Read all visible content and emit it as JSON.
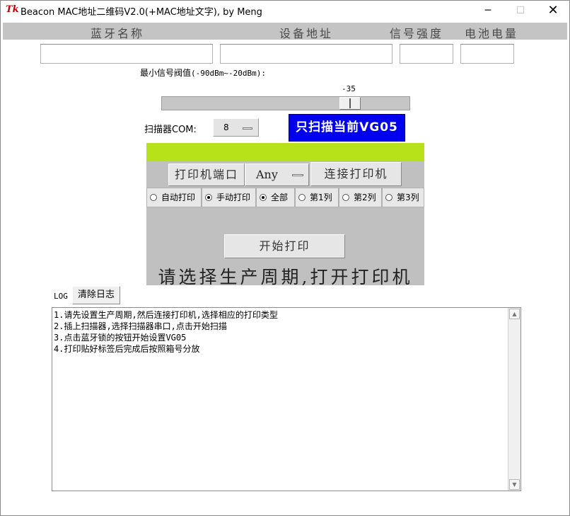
{
  "window": {
    "title": "Beacon MAC地址二维码V2.0(+MAC地址文字), by Meng",
    "icon": "Tk"
  },
  "header": {
    "col_name": "蓝牙名称",
    "col_address": "设备地址",
    "col_signal": "信号强度",
    "col_battery": "电池电量"
  },
  "fields": {
    "name": "",
    "address": "",
    "signal": "",
    "battery": ""
  },
  "threshold": {
    "label": "最小信号阀值",
    "range": "(-90dBm~-20dBm):",
    "value": "-35",
    "min": -90,
    "max": -20
  },
  "scanner": {
    "label": "扫描器COM:",
    "com_value": "8",
    "scan_button": "只扫描当前VG05",
    "scan_button_color": "#0000ee"
  },
  "printer": {
    "accent_color": "#b7e219",
    "port_label": "打印机端口",
    "port_value": "Any",
    "connect_button": "连接打印机",
    "radios": [
      {
        "label": "自动打印",
        "checked": false
      },
      {
        "label": "手动打印",
        "checked": true
      },
      {
        "label": "全部",
        "checked": true
      },
      {
        "label": "第1列",
        "checked": false
      },
      {
        "label": "第2列",
        "checked": false
      },
      {
        "label": "第3列",
        "checked": false
      }
    ],
    "start_button": "开始打印",
    "status_text": "请选择生产周期,打开打印机"
  },
  "log": {
    "label": "LOG",
    "clear_button": "清除日志",
    "lines": [
      "1.请先设置生产周期,然后连接打印机,选择相应的打印类型",
      "2.插上扫描器,选择扫描器串口,点击开始扫描",
      "3.点击蓝牙锁的按钮开始设置VG05",
      "4.打印贴好标签后完成后按照箱号分放"
    ]
  }
}
